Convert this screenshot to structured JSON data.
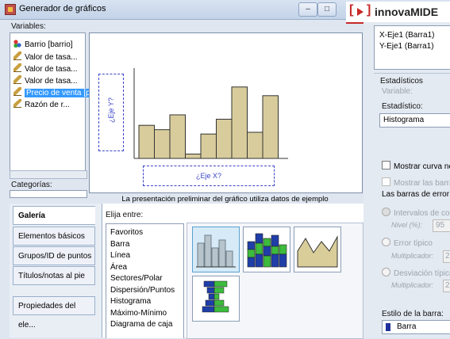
{
  "window": {
    "title": "Generador de gráficos",
    "minimize": "–",
    "maximize": "□",
    "close": "✕"
  },
  "logo": {
    "bracket_left": "[",
    "bracket_right": "]",
    "name": "innovaMIDE"
  },
  "variables": {
    "label": "Variables:",
    "items": [
      {
        "label": "Barrio [barrio]",
        "icon": "nominal-icon"
      },
      {
        "label": "Valor de tasa...",
        "icon": "scale-icon"
      },
      {
        "label": "Valor de tasa...",
        "icon": "scale-icon"
      },
      {
        "label": "Valor de tasa...",
        "icon": "scale-icon"
      },
      {
        "label": "Precio de venta [precio]",
        "icon": "scale-icon",
        "selected": true
      },
      {
        "label": "Razón de r...",
        "icon": "scale-icon"
      }
    ]
  },
  "categories": {
    "label": "Categorías:"
  },
  "canvas": {
    "y_axis_drop": "¿Eje Y?",
    "x_axis_drop": "¿Eje X?",
    "preview_note": "La presentación preliminar del gráfico utiliza datos de ejemplo",
    "sample_bars": [
      0.38,
      0.33,
      0.5,
      0.05,
      0.28,
      0.45,
      0.82,
      0.3,
      0.72
    ]
  },
  "tabs": [
    "Galería",
    "Elementos básicos",
    "Grupos/ID de puntos",
    "Títulos/notas al pie",
    "Propiedades del ele..."
  ],
  "gallery": {
    "choose_label": "Elija entre:",
    "chart_types": [
      "Favoritos",
      "Barra",
      "Línea",
      "Área",
      "Sectores/Polar",
      "Dispersión/Puntos",
      "Histograma",
      "Máximo-Mínimo",
      "Diagrama de caja"
    ]
  },
  "right_panel": {
    "axes": [
      "X-Eje1 (Barra1)",
      "Y-Eje1 (Barra1)"
    ],
    "stats_header": "Estadísticos",
    "variable_label": "Variable:",
    "statistic_label": "Estadístico:",
    "statistic_value": "Histograma",
    "normal_curve": "Mostrar curva no",
    "error_bars_check": "Mostrar las barra",
    "error_bars_repr": "Las barras de error r",
    "ci_option": "Intervalos de co",
    "level_label": "Nivel (%):",
    "level_value": "95",
    "std_error": "Error típico",
    "multiplier_label": "Multiplicador:",
    "multiplier_value": "2",
    "std_dev": "Desviación típica",
    "multiplier2_label": "Multiplicador:",
    "multiplier2_value": "2",
    "bar_style_label": "Estilo de la barra:",
    "bar_style_value": "Barra"
  }
}
